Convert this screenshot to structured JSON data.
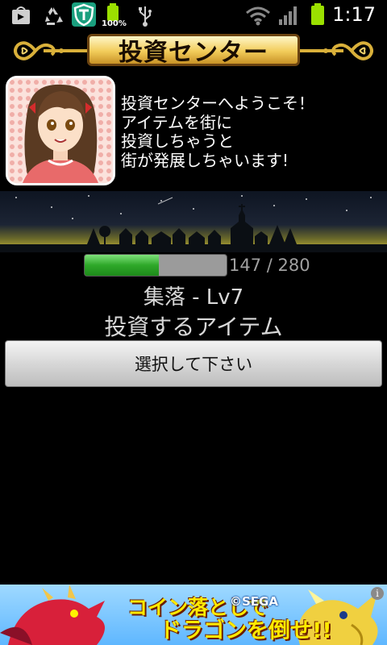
{
  "status_bar": {
    "time": "1:17",
    "battery_label": "100%",
    "icons": [
      "play-store-icon",
      "recycle-icon",
      "t-app-icon",
      "battery-100-icon",
      "usb-icon",
      "wifi-icon",
      "signal-icon",
      "battery-icon"
    ]
  },
  "header": {
    "title": "投資センター"
  },
  "intro": {
    "avatar_icon": "character-portrait",
    "lines": [
      "投資センターへようこそ！",
      "アイテムを街に",
      "投資しちゃうと",
      "街が発展しちゃいます!"
    ]
  },
  "town": {
    "scene_icon": "night-town-silhouette"
  },
  "progress": {
    "current": 147,
    "max": 280,
    "text": "147 / 280"
  },
  "level_text": "集落 - Lv7",
  "invest_label": "投資するアイテム",
  "select_button_label": "選択して下さい",
  "ad": {
    "line1": "コイン落としで",
    "line2": "ドラゴンを倒せ!!",
    "copyright": "©SEGA",
    "info_icon": "info-icon"
  },
  "colors": {
    "progress_fill": "#2ea829",
    "progress_track": "#9b9b9b",
    "banner_gold": "#f2cc5a"
  }
}
